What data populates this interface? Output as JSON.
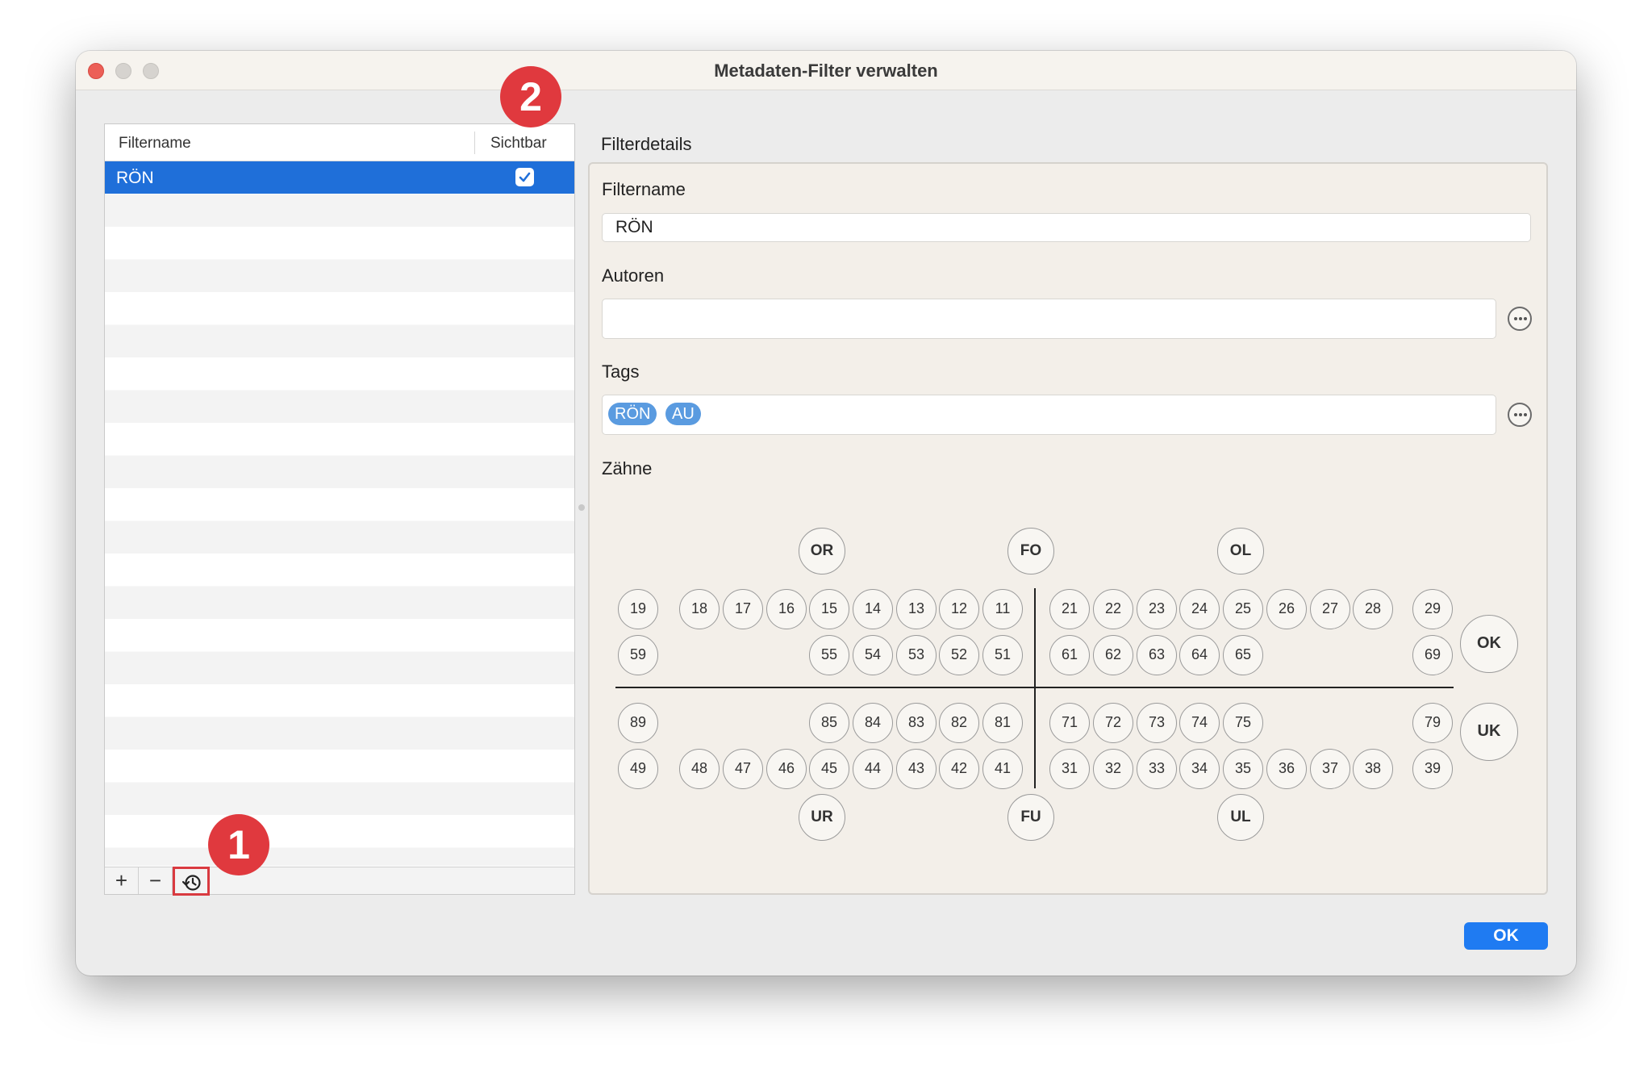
{
  "window": {
    "title": "Metadaten-Filter verwalten"
  },
  "list": {
    "columns": {
      "name": "Filtername",
      "visible": "Sichtbar"
    },
    "rows": [
      {
        "name": "RÖN",
        "visible": true
      }
    ],
    "footer": {
      "add": "+",
      "remove": "−"
    }
  },
  "badges": {
    "one": "1",
    "two": "2"
  },
  "details": {
    "section_label": "Filterdetails",
    "filtername_label": "Filtername",
    "filtername_value": "RÖN",
    "authors_label": "Autoren",
    "authors_value": "",
    "tags_label": "Tags",
    "tags": [
      "RÖN",
      "AU"
    ],
    "teeth_label": "Zähne"
  },
  "teeth": {
    "regions_top": [
      "OR",
      "FO",
      "OL"
    ],
    "regions_bottom": [
      "UR",
      "FU",
      "UL"
    ],
    "jaws": [
      "OK",
      "UK"
    ],
    "upper_perm_right": [
      "18",
      "17",
      "16",
      "15",
      "14",
      "13",
      "12",
      "11"
    ],
    "upper_perm_left": [
      "21",
      "22",
      "23",
      "24",
      "25",
      "26",
      "27",
      "28"
    ],
    "upper_decid_right": [
      "55",
      "54",
      "53",
      "52",
      "51"
    ],
    "upper_decid_left": [
      "61",
      "62",
      "63",
      "64",
      "65"
    ],
    "lower_decid_right": [
      "85",
      "84",
      "83",
      "82",
      "81"
    ],
    "lower_decid_left": [
      "71",
      "72",
      "73",
      "74",
      "75"
    ],
    "lower_perm_right": [
      "48",
      "47",
      "46",
      "45",
      "44",
      "43",
      "42",
      "41"
    ],
    "lower_perm_left": [
      "31",
      "32",
      "33",
      "34",
      "35",
      "36",
      "37",
      "38"
    ],
    "side_left": [
      "19",
      "59",
      "89",
      "49"
    ],
    "side_right": [
      "29",
      "69",
      "79",
      "39"
    ]
  },
  "buttons": {
    "ok": "OK"
  }
}
